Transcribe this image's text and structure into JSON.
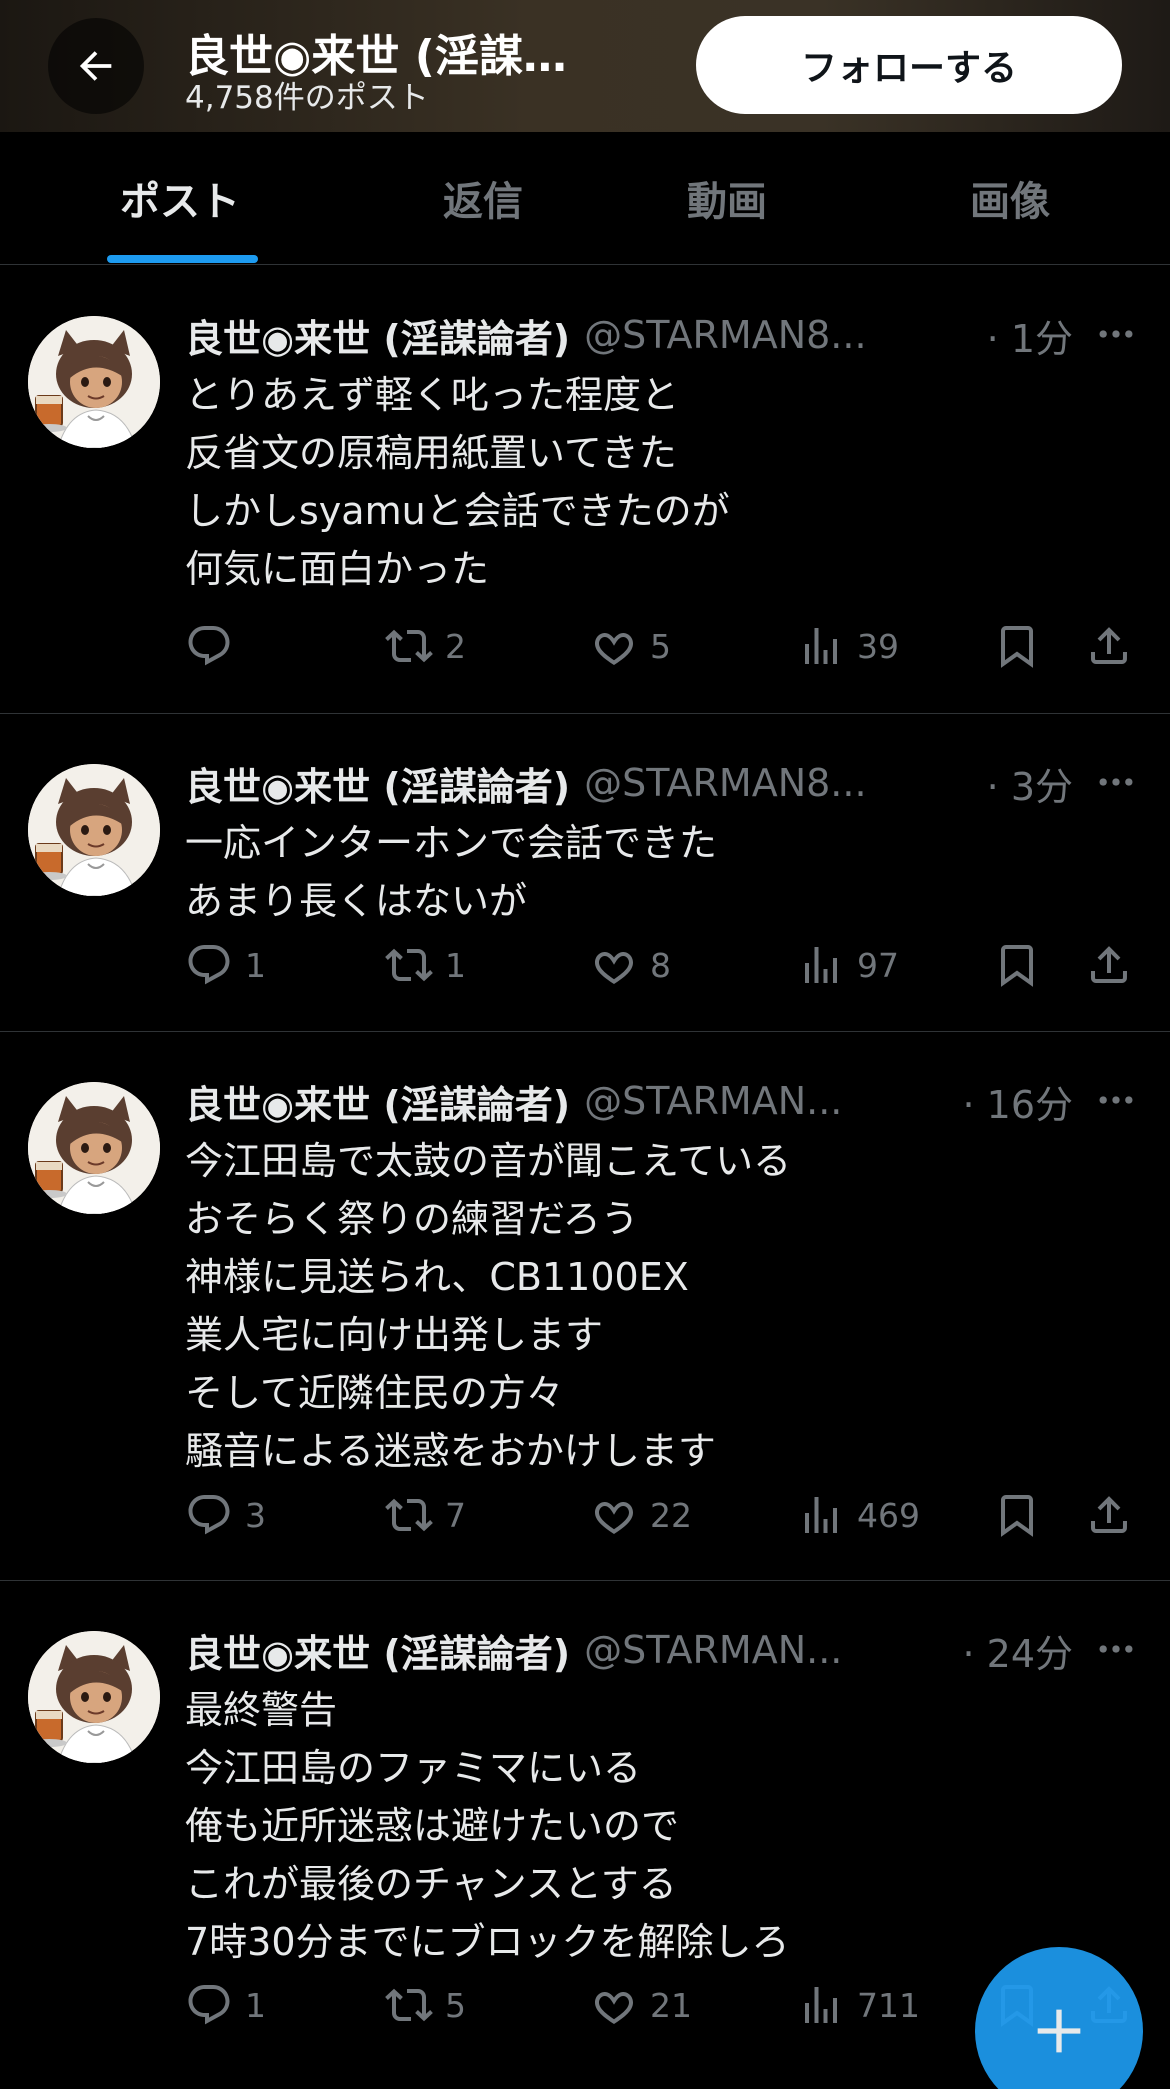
{
  "header": {
    "title": "良世◉来世 (淫謀…",
    "post_count": "4,758件のポスト",
    "follow_label": "フォローする"
  },
  "tabs": [
    {
      "label": "ポスト",
      "active": true
    },
    {
      "label": "返信",
      "active": false
    },
    {
      "label": "動画",
      "active": false
    },
    {
      "label": "画像",
      "active": false
    }
  ],
  "colors": {
    "accent": "#1d9bf0",
    "background": "#000000",
    "secondary_text": "#71767b",
    "primary_text": "#e7e9ea"
  },
  "icons": {
    "back": "arrow-left-icon",
    "more": "more-horizontal-icon",
    "reply": "reply-icon",
    "repost": "repost-icon",
    "like": "heart-icon",
    "views": "views-icon",
    "bookmark": "bookmark-icon",
    "share": "share-icon",
    "compose": "plus-icon"
  },
  "posts": [
    {
      "name": "良世◉来世 (淫謀論者)",
      "handle": "@STARMAN8...",
      "time": "· 1分",
      "lines": [
        "とりあえず軽く叱った程度と",
        "反省文の原稿用紙置いてきた",
        "しかしsyamuと会話できたのが",
        "何気に面白かった"
      ],
      "replies": "",
      "reposts": "2",
      "likes": "5",
      "views": "39"
    },
    {
      "name": "良世◉来世 (淫謀論者)",
      "handle": "@STARMAN8...",
      "time": "· 3分",
      "lines": [
        "一応インターホンで会話できた",
        "あまり長くはないが"
      ],
      "replies": "1",
      "reposts": "1",
      "likes": "8",
      "views": "97"
    },
    {
      "name": "良世◉来世 (淫謀論者)",
      "handle": "@STARMAN...",
      "time": "· 16分",
      "lines": [
        "今江田島で太鼓の音が聞こえている",
        "おそらく祭りの練習だろう",
        "神様に見送られ、CB1100EX",
        "業人宅に向け出発します",
        "そして近隣住民の方々",
        "騒音による迷惑をおかけします"
      ],
      "replies": "3",
      "reposts": "7",
      "likes": "22",
      "views": "469"
    },
    {
      "name": "良世◉来世 (淫謀論者)",
      "handle": "@STARMAN...",
      "time": "· 24分",
      "lines": [
        "最終警告",
        "今江田島のファミマにいる",
        "俺も近所迷惑は避けたいので",
        "これが最後のチャンスとする",
        "7時30分までにブロックを解除しろ"
      ],
      "replies": "1",
      "reposts": "5",
      "likes": "21",
      "views": "711"
    }
  ]
}
